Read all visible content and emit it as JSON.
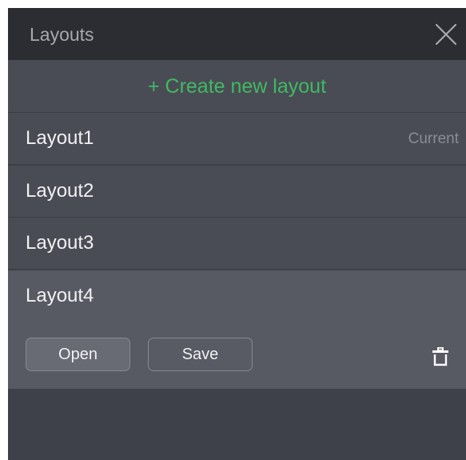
{
  "panel": {
    "title": "Layouts",
    "close_icon": "close-icon"
  },
  "create": {
    "label": "+ Create new layout"
  },
  "layouts": [
    {
      "name": "Layout1",
      "status": "Current"
    },
    {
      "name": "Layout2",
      "status": ""
    },
    {
      "name": "Layout3",
      "status": ""
    },
    {
      "name": "Layout4",
      "status": ""
    }
  ],
  "selected_actions": {
    "open_label": "Open",
    "save_label": "Save",
    "delete_icon": "trash-icon"
  },
  "colors": {
    "header_bg": "#2c2d33",
    "panel_bg": "#3f414a",
    "row_bg": "#4a4c55",
    "selected_bg": "#575963",
    "accent_green": "#3fba62"
  }
}
